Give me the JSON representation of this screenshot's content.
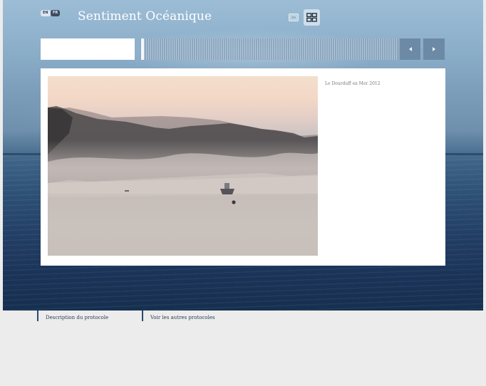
{
  "header": {
    "languages": [
      {
        "code": "EN",
        "active": false
      },
      {
        "code": "FR",
        "active": true
      }
    ],
    "site_title": "Sentiment Océanique",
    "view_modes": [
      {
        "icon": "single-view-icon",
        "active": false
      },
      {
        "icon": "grid-view-icon",
        "active": true
      }
    ]
  },
  "toolbar": {
    "search_value": "",
    "prev_icon": "chevron-left-icon",
    "next_icon": "chevron-right-icon"
  },
  "content": {
    "photo_icon": "foggy-river-photo",
    "caption": "Le Dourduff en Mer 2012"
  },
  "footer": {
    "links": [
      "Description du protocole",
      "Voir les autres protocoles"
    ]
  },
  "colors": {
    "page_bg": "#ececec",
    "accent": "#2b4a6e",
    "panel_bg": "#ffffff"
  }
}
